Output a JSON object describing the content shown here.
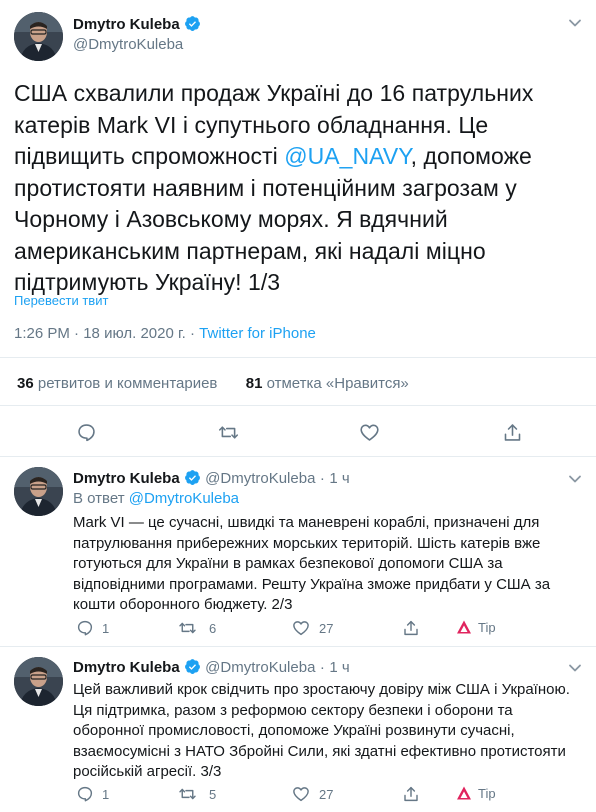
{
  "main_tweet": {
    "author_name": "Dmytro Kuleba",
    "author_handle": "@DmytroKuleba",
    "text_part1": "США схвалили продаж Україні до 16 патрульних катерів Mark VI і супутнього обладнання. Це підвищить спроможності ",
    "mention": "@UA_NAVY",
    "text_part2": ", допоможе протистояти наявним і потенційним загрозам у Чорному і Азовському морях. Я вдячний американським партнерам, які надалі міцно підтримують Україну! 1/3",
    "translate_label": "Перевести твит",
    "time": "1:26 PM",
    "date": "18 июл. 2020 г.",
    "separator": "·",
    "source": "Twitter for iPhone",
    "retweets_count": "36",
    "retweets_label": "ретвитов и комментариев",
    "likes_count": "81",
    "likes_label": "отметка «Нравится»"
  },
  "replies": [
    {
      "author_name": "Dmytro Kuleba",
      "author_handle": "@DmytroKuleba",
      "time": "1 ч",
      "separator": "·",
      "reply_to_label": "В ответ",
      "reply_to_handle": "@DmytroKuleba",
      "text": "Mark VI — це сучасні, швидкі та маневрені кораблі, призначені для патрулювання прибережних морських територій. Шість катерів вже готуються для України в рамках безпекової допомоги США за відповідними програмами. Решту Україна зможе придбати у США за кошти оборонного бюджету. 2/3",
      "reply_count": "1",
      "retweet_count": "6",
      "like_count": "27",
      "tip_label": "Tip"
    },
    {
      "author_name": "Dmytro Kuleba",
      "author_handle": "@DmytroKuleba",
      "time": "1 ч",
      "separator": "·",
      "text": "Цей важливий крок свідчить про зростаючу довіру між США і Україною. Ця підтримка, разом з реформою сектору безпеки і оборони та оборонної промисловості, допоможе Україні розвинути сучасні, взаємосумісні з НАТО Збройні Сили, які здатні ефективно протистояти російській агресії. 3/3",
      "reply_count": "1",
      "retweet_count": "5",
      "like_count": "27",
      "tip_label": "Tip"
    }
  ],
  "colors": {
    "accent": "#1da1f2",
    "text": "#14171a",
    "secondary": "#657786",
    "divider": "#e6ecf0",
    "tip_icon": "#e0245e"
  },
  "icons": [
    "avatar",
    "verified-badge-icon",
    "chevron-down-icon",
    "reply-icon",
    "retweet-icon",
    "like-icon",
    "share-icon",
    "tip-icon"
  ]
}
